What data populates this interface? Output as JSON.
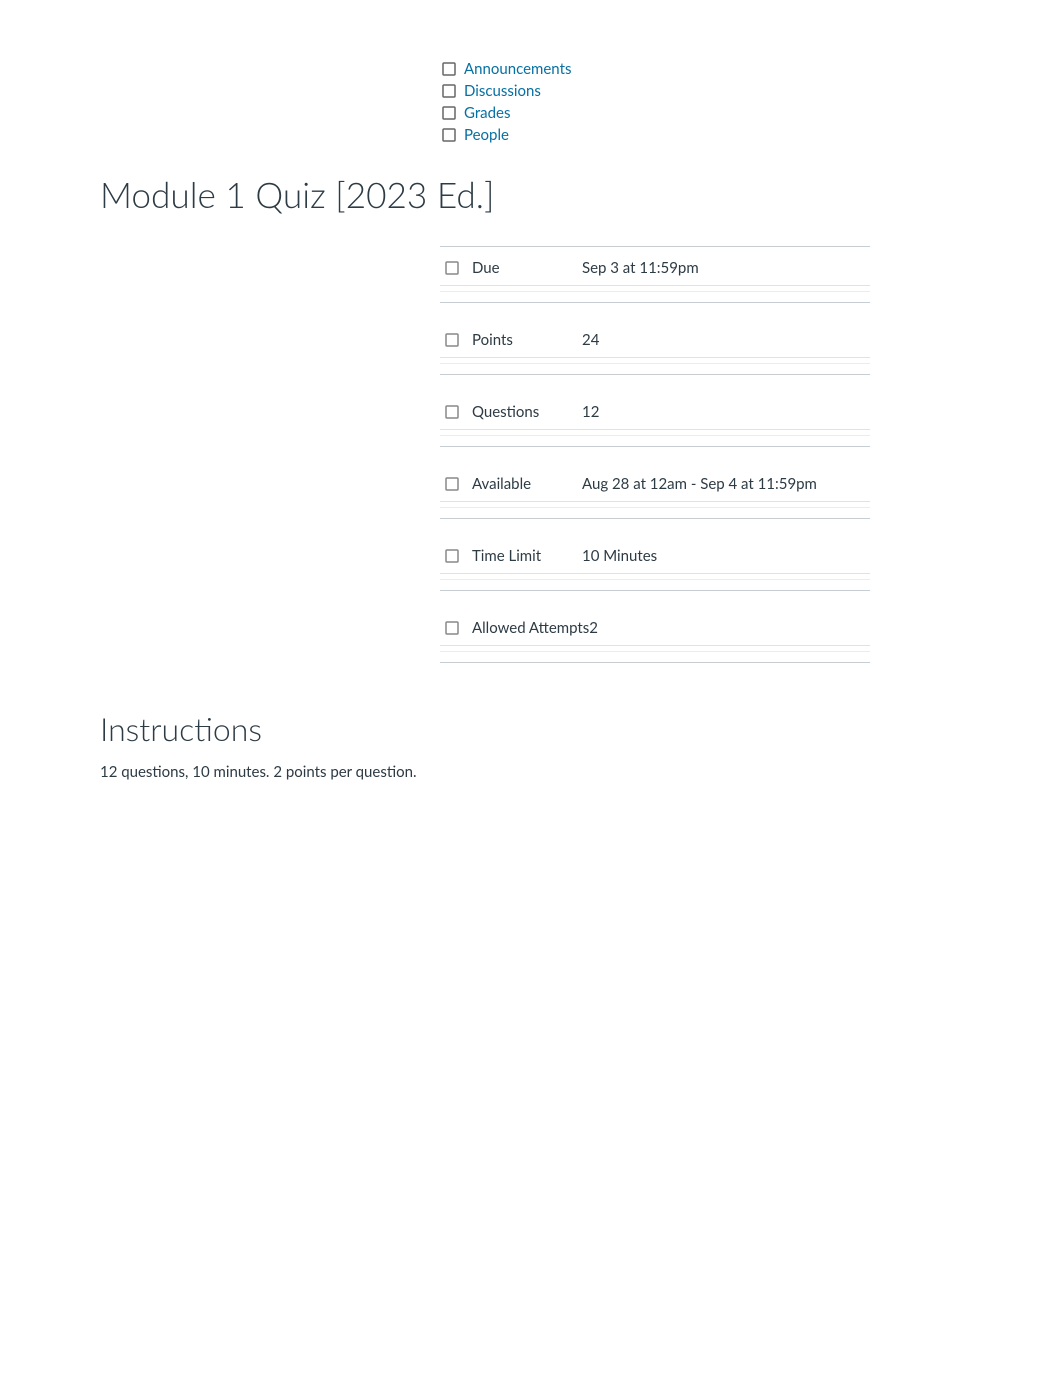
{
  "nav": {
    "items": [
      {
        "label": "Announcements",
        "icon": "□"
      },
      {
        "label": "Discussions",
        "icon": "□"
      },
      {
        "label": "Grades",
        "icon": "□"
      },
      {
        "label": "People",
        "icon": "□"
      }
    ]
  },
  "quiz": {
    "title": "Module 1 Quiz [2023 Ed.]",
    "details": [
      {
        "icon": "□",
        "label": "Due",
        "value": "Sep 3 at 11:59pm"
      },
      {
        "icon": "□",
        "label": "Points",
        "value": "24"
      },
      {
        "icon": "□",
        "label": "Questions",
        "value": "12"
      },
      {
        "icon": "□",
        "label": "Available",
        "value": "Aug 28 at 12am - Sep 4 at 11:59pm"
      },
      {
        "icon": "□",
        "label": "Time Limit",
        "value": "10 Minutes"
      },
      {
        "icon": "□",
        "label": "Allowed Attempts",
        "value": "2"
      }
    ],
    "instructions": {
      "title": "Instructions",
      "text": "12 questions, 10 minutes. 2 points per question."
    }
  }
}
